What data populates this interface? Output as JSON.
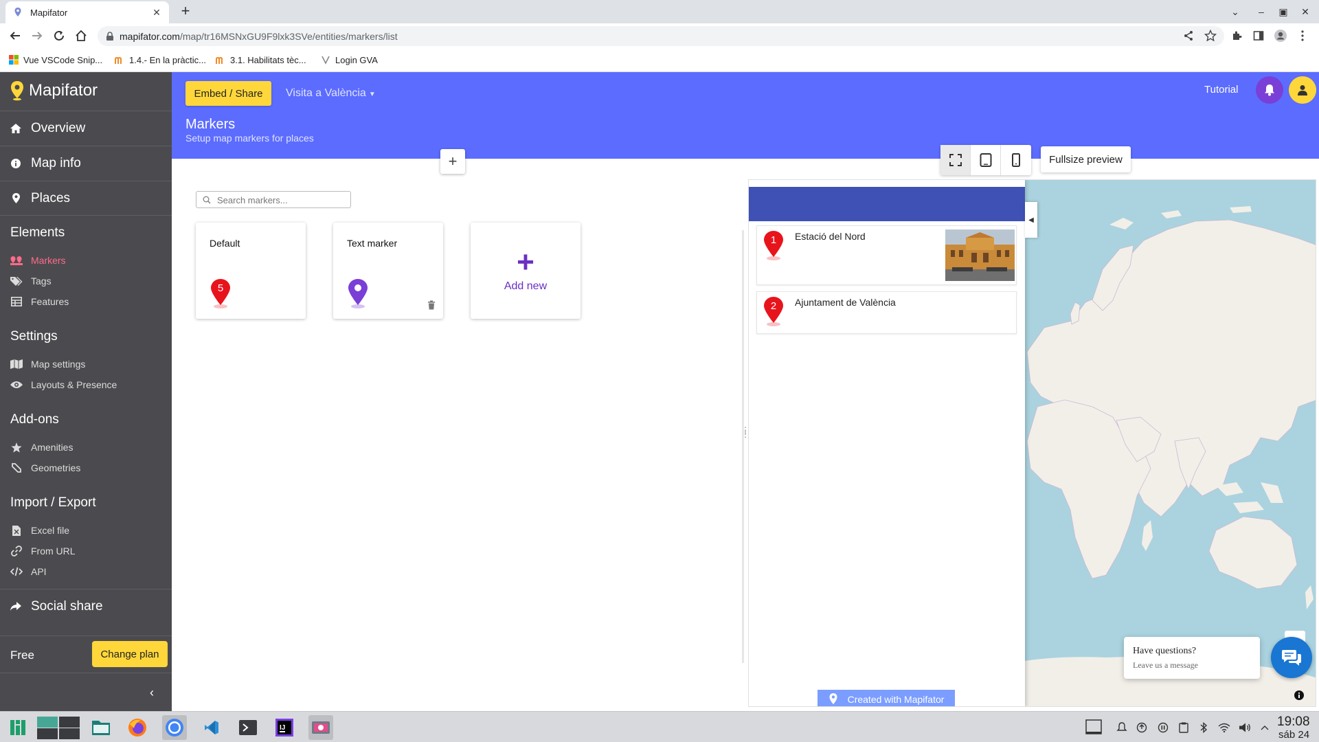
{
  "browser": {
    "tab_title": "Mapifator",
    "url_host": "mapifator.com",
    "url_path": "/map/tr16MSNxGU9F9lxk3SVe/entities/markers/list",
    "bookmarks": [
      {
        "label": "Vue VSCode Snip..."
      },
      {
        "label": "1.4.- En la pràctic..."
      },
      {
        "label": "3.1. Habilitats tèc..."
      },
      {
        "label": "Login GVA"
      }
    ]
  },
  "sidebar": {
    "brand": "Mapifator",
    "main_items": [
      {
        "label": "Overview",
        "icon": "home-icon"
      },
      {
        "label": "Map info",
        "icon": "info-icon"
      },
      {
        "label": "Places",
        "icon": "map-pin-icon"
      }
    ],
    "elements_heading": "Elements",
    "elements": [
      {
        "label": "Markers",
        "icon": "markers-icon",
        "active": true
      },
      {
        "label": "Tags",
        "icon": "tags-icon"
      },
      {
        "label": "Features",
        "icon": "table-icon"
      }
    ],
    "settings_heading": "Settings",
    "settings": [
      {
        "label": "Map settings",
        "icon": "map-icon"
      },
      {
        "label": "Layouts & Presence",
        "icon": "eye-icon"
      }
    ],
    "addons_heading": "Add-ons",
    "addons": [
      {
        "label": "Amenities",
        "icon": "star-icon"
      },
      {
        "label": "Geometries",
        "icon": "geometry-icon"
      }
    ],
    "import_heading": "Import / Export",
    "import": [
      {
        "label": "Excel file",
        "icon": "excel-icon"
      },
      {
        "label": "From URL",
        "icon": "link-icon"
      },
      {
        "label": "API",
        "icon": "code-icon"
      }
    ],
    "social_share": "Social share",
    "plan": "Free",
    "change_plan": "Change plan"
  },
  "header": {
    "embed_label": "Embed / Share",
    "map_name": "Visita a València",
    "title": "Markers",
    "subtitle": "Setup map markers for places",
    "tutorial": "Tutorial"
  },
  "main": {
    "search_placeholder": "Search markers...",
    "cards": [
      {
        "title": "Default",
        "marker_label": "5",
        "marker_color": "#e8141c"
      },
      {
        "title": "Text marker",
        "marker_color": "#7a3fd6"
      }
    ],
    "add_new": "Add new"
  },
  "preview": {
    "fullsize_label": "Fullsize preview",
    "places": [
      {
        "number": "1",
        "name": "Estació del Nord"
      },
      {
        "number": "2",
        "name": "Ajuntament de València"
      }
    ],
    "created_with": "Created with Mapifator",
    "colors": {
      "list_header": "#3f51b5",
      "ocean": "#aad3df",
      "land": "#f2efe9"
    }
  },
  "chat": {
    "question": "Have questions?",
    "message": "Leave us a message"
  },
  "taskbar": {
    "time": "19:08",
    "date": "sáb 24"
  },
  "colors": {
    "accent": "#5c6cff",
    "sidebar": "#4b4b4f",
    "button_yellow": "#ffd73a",
    "active_nav": "#ff6b8a"
  }
}
